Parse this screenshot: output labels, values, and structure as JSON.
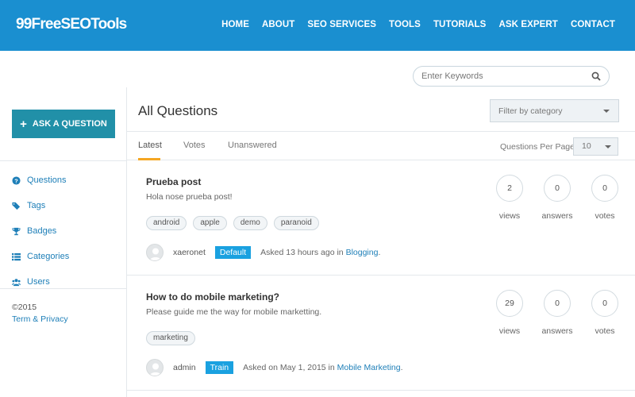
{
  "header": {
    "logo": "99FreeSEOTools",
    "nav": [
      "HOME",
      "ABOUT",
      "SEO SERVICES",
      "TOOLS",
      "TUTORIALS",
      "ASK EXPERT",
      "CONTACT"
    ]
  },
  "search": {
    "placeholder": "Enter Keywords",
    "icon": "search-icon"
  },
  "sidebar": {
    "ask_button": "ASK A QUESTION",
    "menu": [
      {
        "label": "Questions",
        "icon": "question-circle-icon"
      },
      {
        "label": "Tags",
        "icon": "tags-icon"
      },
      {
        "label": "Badges",
        "icon": "trophy-icon"
      },
      {
        "label": "Categories",
        "icon": "list-icon"
      },
      {
        "label": "Users",
        "icon": "users-icon"
      }
    ],
    "copyright": "©2015",
    "terms": "Term & Privacy"
  },
  "main": {
    "title": "All Questions",
    "filter_placeholder": "Filter by category",
    "tabs": [
      "Latest",
      "Votes",
      "Unanswered"
    ],
    "active_tab": "Latest",
    "per_page_label": "Questions Per Page:",
    "per_page_value": "10"
  },
  "questions": [
    {
      "title": "Prueba post",
      "excerpt": "Hola nose prueba post!",
      "tags": [
        "android",
        "apple",
        "demo",
        "paranoid"
      ],
      "author": "xaeronet",
      "badge": "Default",
      "asked": "Asked 13 hours ago in ",
      "category": "Blogging",
      "views": "2",
      "answers": "0",
      "votes": "0"
    },
    {
      "title": "How to do mobile marketing?",
      "excerpt": "Please guide me the way for  mobile marketting.",
      "tags": [
        "marketing"
      ],
      "author": "admin",
      "badge": "Train",
      "asked": "Asked on May 1, 2015 in ",
      "category": "Mobile Marketing",
      "views": "29",
      "answers": "0",
      "votes": "0"
    }
  ],
  "stat_labels": {
    "views": "views",
    "answers": "answers",
    "votes": "votes"
  },
  "colors": {
    "header": "#1a8fd0",
    "ask_button": "#2190a8",
    "link": "#1e7fb8",
    "badge": "#1aa1e0",
    "tab_underline": "#f5a623"
  }
}
